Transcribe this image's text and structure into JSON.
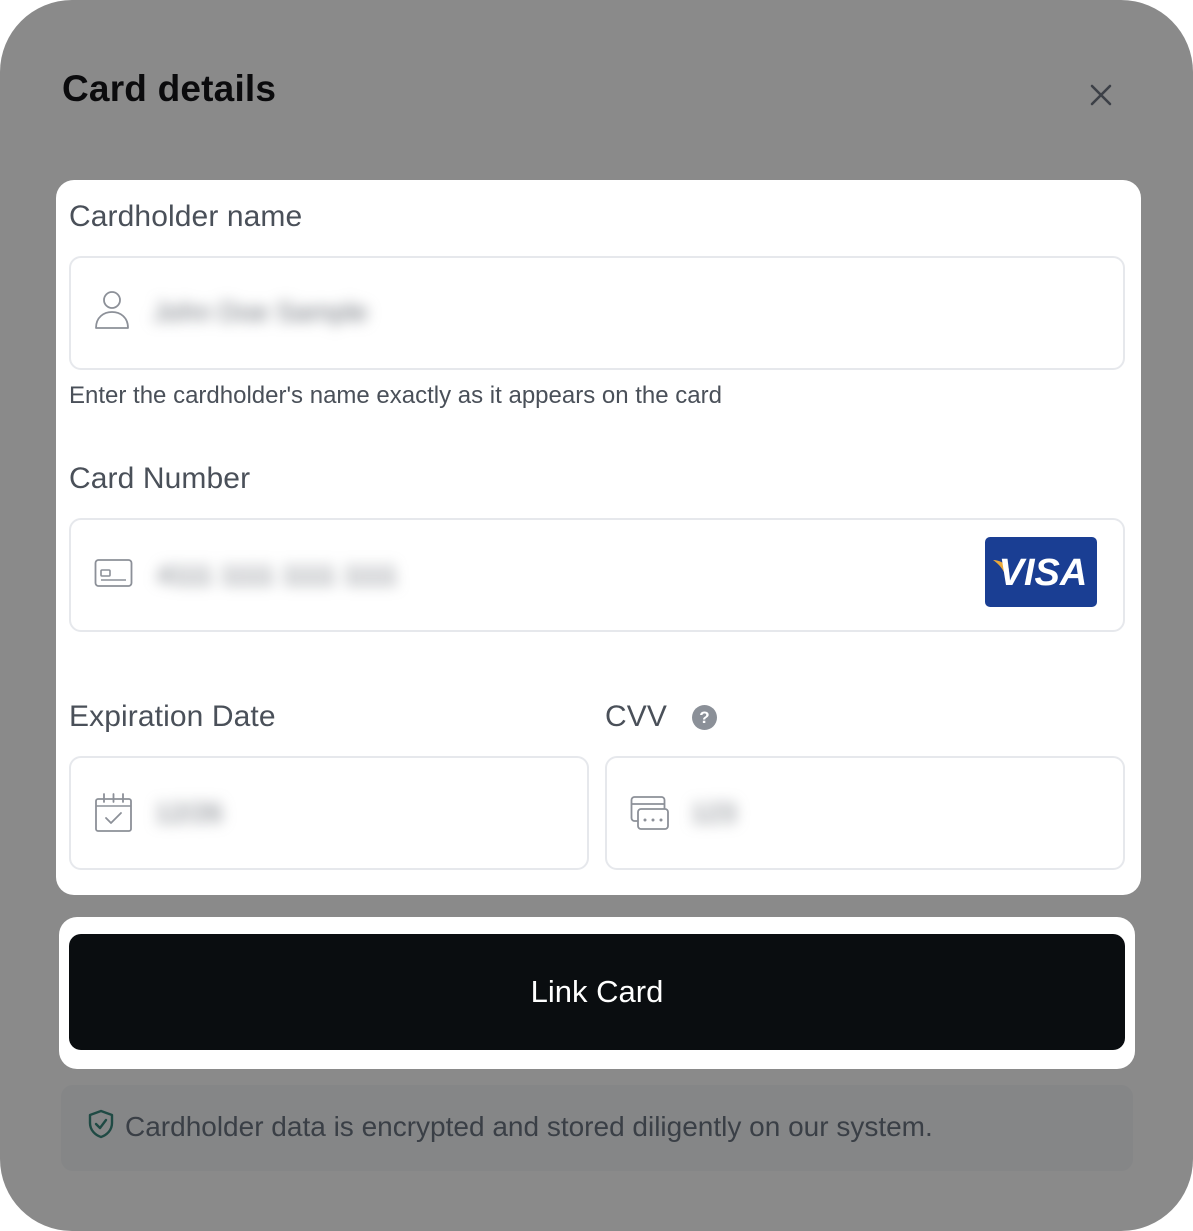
{
  "dialog": {
    "title": "Card details",
    "close_icon": "close-icon"
  },
  "cardholder": {
    "label": "Cardholder name",
    "icon": "user-icon",
    "value_redacted": "John Doe Sample",
    "helper": "Enter the cardholder's name exactly as it appears on the card"
  },
  "card_number": {
    "label": "Card Number",
    "icon": "credit-card-icon",
    "value_redacted": "4111 1111 1111 1111",
    "brand": "VISA",
    "brand_color": "#1a3e93"
  },
  "expiration": {
    "label": "Expiration Date",
    "icon": "calendar-check-icon",
    "value_redacted": "12/26"
  },
  "cvv": {
    "label": "CVV",
    "help_icon": "question-circle-icon",
    "icon": "card-cvv-icon",
    "value_redacted": "123"
  },
  "submit": {
    "label": "Link Card"
  },
  "notice": {
    "icon": "shield-check-icon",
    "text": "Cardholder data is encrypted and stored diligently on our system."
  },
  "colors": {
    "overlay": "#8a8a8a",
    "button": "#0a0d10",
    "label": "#4a5059"
  }
}
